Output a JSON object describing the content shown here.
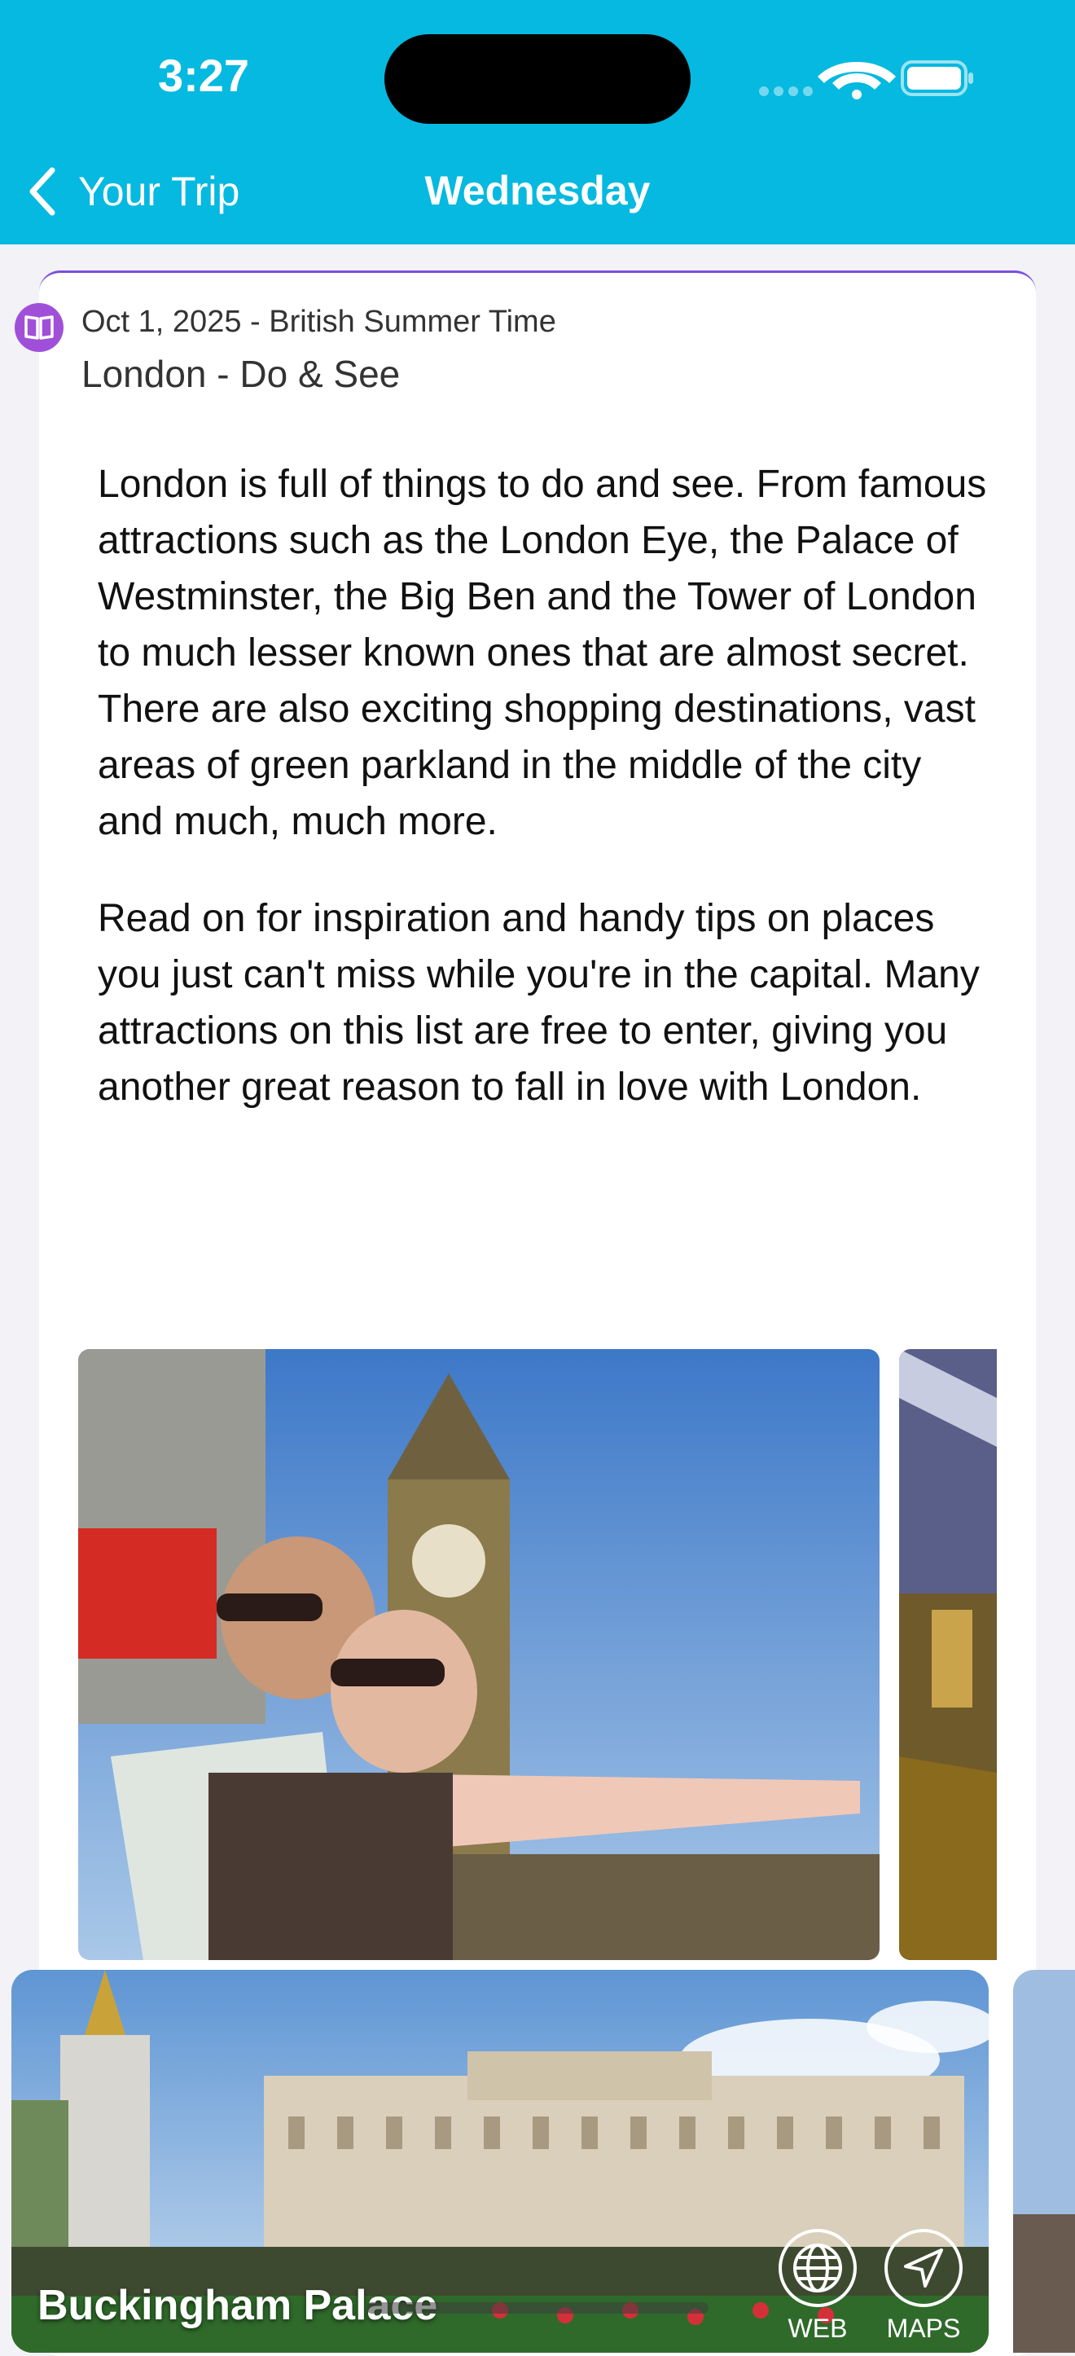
{
  "status_bar": {
    "time": "3:27"
  },
  "nav": {
    "back_label": "Your Trip",
    "title": "Wednesday"
  },
  "entry": {
    "date_line": "Oct 1, 2025 - British Summer Time",
    "title": "London - Do & See",
    "paragraphs": [
      "London is full of things to do and see. From famous attractions such as the London Eye, the Palace of Westminster, the Big Ben and the Tower of London to much lesser known ones that are almost secret. There are also exciting shopping destinations, vast areas of green parkland in the middle of the city and much, much more.",
      "Read on for inspiration and handy tips on places you just can't miss while you're in the capital. Many attractions on this list are free to enter, giving you another great reason to fall in love with London."
    ]
  },
  "poi": {
    "name": "Buckingham Palace",
    "web_label": "WEB",
    "maps_label": "MAPS"
  },
  "colors": {
    "header": "#05b9e0",
    "accent": "#7b4fe0",
    "book_icon": "#a050d8"
  },
  "icons": [
    "chevron-left-icon",
    "wifi-icon",
    "battery-icon",
    "book-icon",
    "globe-icon",
    "location-arrow-icon"
  ]
}
